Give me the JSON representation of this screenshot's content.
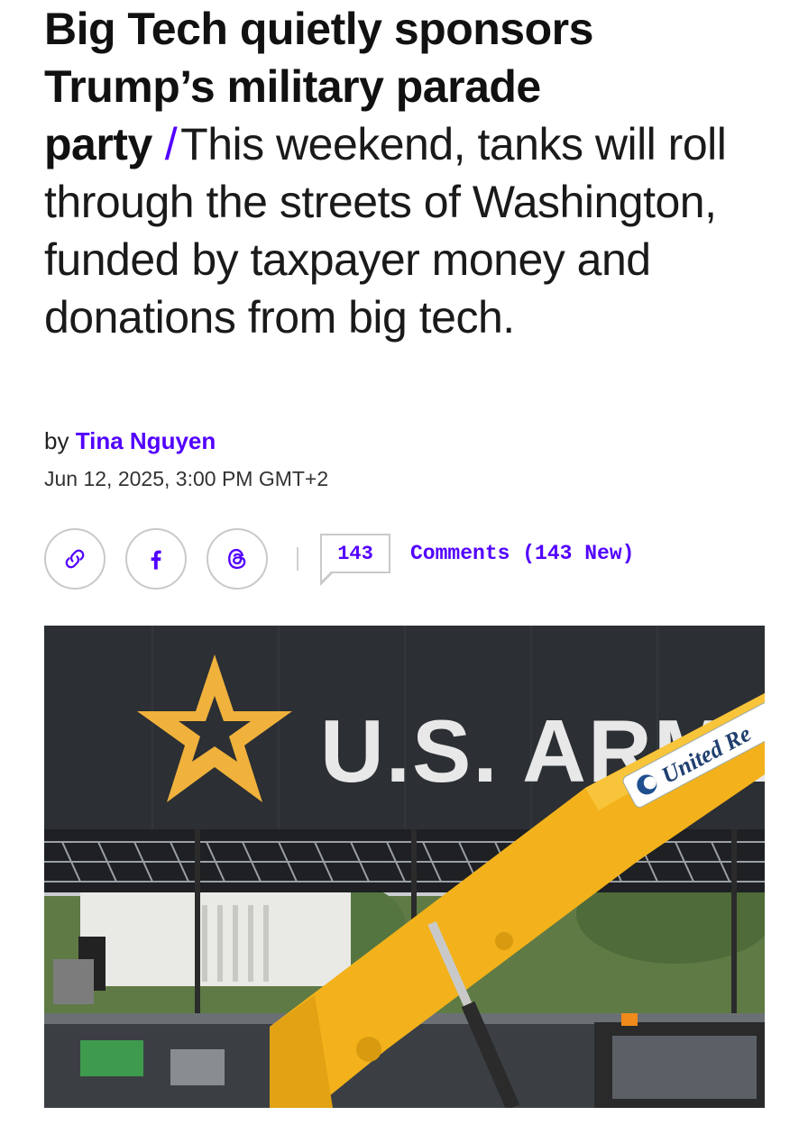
{
  "article": {
    "headline": "Big Tech quietly sponsors Trump’s military parade party",
    "separator": "/",
    "dek": "This weekend, tanks will roll through the streets of Washington, funded by taxpayer money and donations from big tech.",
    "byline_prefix": "by",
    "author": "Tina Nguyen",
    "date": "Jun 12, 2025, 3:00 PM GMT+2"
  },
  "share": {
    "icons": [
      "link-icon",
      "facebook-icon",
      "threads-icon"
    ],
    "comment_count": "143",
    "comments_label": "Comments (143 New)"
  },
  "photo": {
    "banner_text": "U.S. ARMY",
    "sticker_text": "United Re"
  },
  "colors": {
    "accent": "#5200ff",
    "banner": "#2c2f33",
    "star": "#f0b23c",
    "boom": "#f3b21b"
  }
}
